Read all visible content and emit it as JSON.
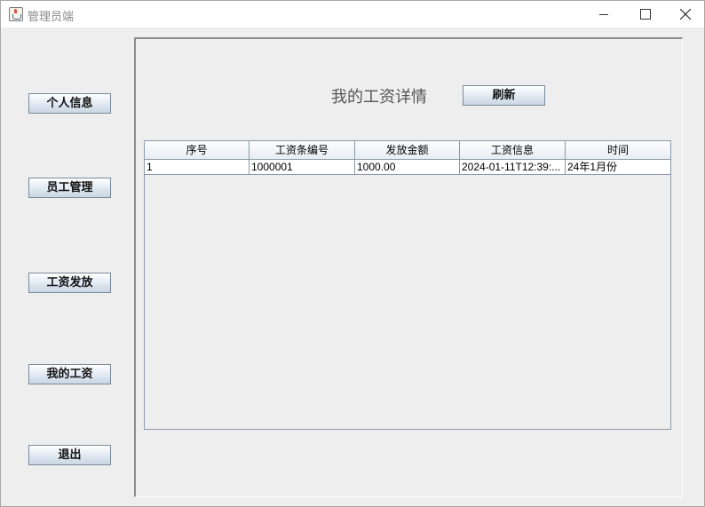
{
  "window": {
    "title": "管理员端"
  },
  "icons": {
    "app": "java-coffee-cup-icon",
    "minimize": "minimize-icon",
    "maximize": "maximize-icon",
    "close": "close-icon"
  },
  "sidebar": {
    "items": [
      {
        "label": "个人信息"
      },
      {
        "label": "员工管理"
      },
      {
        "label": "工资发放"
      },
      {
        "label": "我的工资"
      },
      {
        "label": "退出"
      }
    ]
  },
  "main": {
    "title": "我的工资详情",
    "refresh_label": "刷新",
    "table": {
      "columns": [
        "序号",
        "工资条编号",
        "发放金额",
        "工资信息",
        "时间"
      ],
      "rows": [
        [
          "1",
          "1000001",
          "1000.00",
          "2024-01-11T12:39:...",
          "24年1月份"
        ]
      ]
    }
  }
}
